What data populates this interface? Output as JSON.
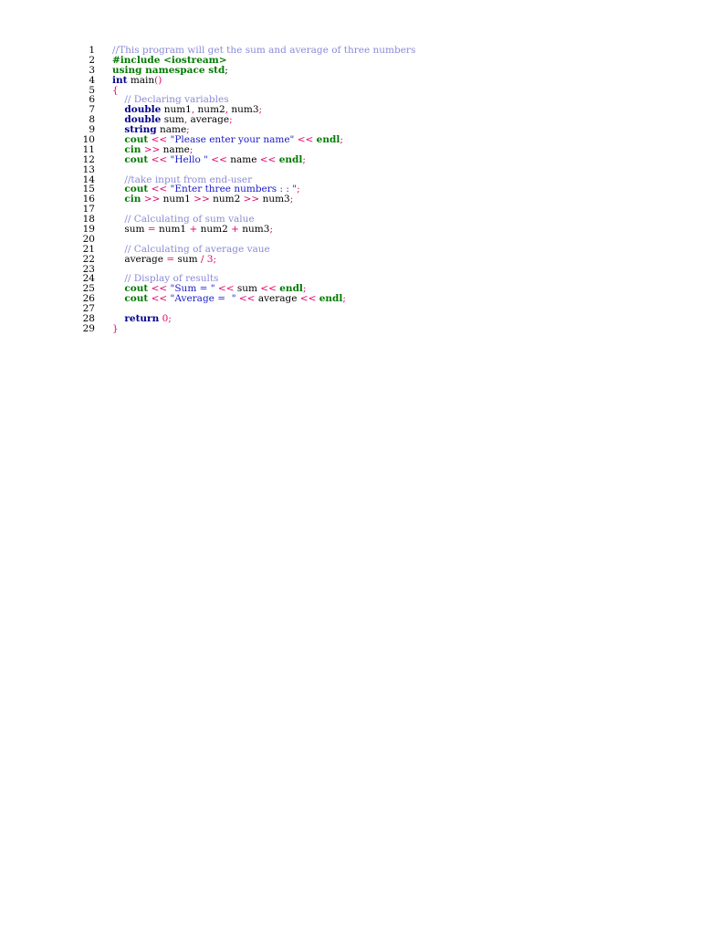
{
  "document": {
    "lines": [
      {
        "n": "1",
        "tokens": [
          {
            "t": "//This program will get the sum and average of three numbers",
            "c": "comment"
          }
        ]
      },
      {
        "n": "2",
        "tokens": [
          {
            "t": "#include <iostream>",
            "c": "pre"
          }
        ]
      },
      {
        "n": "3",
        "tokens": [
          {
            "t": "using namespace ",
            "c": "stdkw"
          },
          {
            "t": "std",
            "c": "stdkw"
          },
          {
            "t": ";",
            "c": "punct"
          }
        ]
      },
      {
        "n": "4",
        "tokens": [
          {
            "t": "int",
            "c": "kw"
          },
          {
            "t": " main",
            "c": "id"
          },
          {
            "t": "()",
            "c": "op"
          }
        ]
      },
      {
        "n": "5",
        "tokens": [
          {
            "t": "{",
            "c": "op"
          }
        ]
      },
      {
        "n": "6",
        "tokens": [
          {
            "t": "    // Declaring variables",
            "c": "comment"
          }
        ]
      },
      {
        "n": "7",
        "tokens": [
          {
            "t": "    ",
            "c": "id"
          },
          {
            "t": "double",
            "c": "kw"
          },
          {
            "t": " num1",
            "c": "id"
          },
          {
            "t": ",",
            "c": "op"
          },
          {
            "t": " num2",
            "c": "id"
          },
          {
            "t": ",",
            "c": "op"
          },
          {
            "t": " num3",
            "c": "id"
          },
          {
            "t": ";",
            "c": "op"
          }
        ]
      },
      {
        "n": "8",
        "tokens": [
          {
            "t": "    ",
            "c": "id"
          },
          {
            "t": "double",
            "c": "kw"
          },
          {
            "t": " sum",
            "c": "id"
          },
          {
            "t": ",",
            "c": "op"
          },
          {
            "t": " average",
            "c": "id"
          },
          {
            "t": ";",
            "c": "op"
          }
        ]
      },
      {
        "n": "9",
        "tokens": [
          {
            "t": "    ",
            "c": "id"
          },
          {
            "t": "string",
            "c": "kw"
          },
          {
            "t": " name",
            "c": "id"
          },
          {
            "t": ";",
            "c": "op"
          }
        ]
      },
      {
        "n": "10",
        "tokens": [
          {
            "t": "    ",
            "c": "id"
          },
          {
            "t": "cout",
            "c": "stdkw"
          },
          {
            "t": " << ",
            "c": "op"
          },
          {
            "t": "\"Please enter your name\"",
            "c": "str"
          },
          {
            "t": " << ",
            "c": "op"
          },
          {
            "t": "endl",
            "c": "stdkw"
          },
          {
            "t": ";",
            "c": "op"
          }
        ]
      },
      {
        "n": "11",
        "tokens": [
          {
            "t": "    ",
            "c": "id"
          },
          {
            "t": "cin",
            "c": "stdkw"
          },
          {
            "t": " >> ",
            "c": "op"
          },
          {
            "t": "name",
            "c": "id"
          },
          {
            "t": ";",
            "c": "op"
          }
        ]
      },
      {
        "n": "12",
        "tokens": [
          {
            "t": "    ",
            "c": "id"
          },
          {
            "t": "cout",
            "c": "stdkw"
          },
          {
            "t": " << ",
            "c": "op"
          },
          {
            "t": "\"Hello \"",
            "c": "str"
          },
          {
            "t": " << ",
            "c": "op"
          },
          {
            "t": "name",
            "c": "id"
          },
          {
            "t": " << ",
            "c": "op"
          },
          {
            "t": "endl",
            "c": "stdkw"
          },
          {
            "t": ";",
            "c": "op"
          }
        ]
      },
      {
        "n": "13",
        "tokens": []
      },
      {
        "n": "14",
        "tokens": [
          {
            "t": "    //take input from end-user",
            "c": "comment"
          }
        ]
      },
      {
        "n": "15",
        "tokens": [
          {
            "t": "    ",
            "c": "id"
          },
          {
            "t": "cout",
            "c": "stdkw"
          },
          {
            "t": " << ",
            "c": "op"
          },
          {
            "t": "\"Enter three numbers : : \"",
            "c": "str"
          },
          {
            "t": ";",
            "c": "op"
          }
        ]
      },
      {
        "n": "16",
        "tokens": [
          {
            "t": "    ",
            "c": "id"
          },
          {
            "t": "cin",
            "c": "stdkw"
          },
          {
            "t": " >> ",
            "c": "op"
          },
          {
            "t": "num1",
            "c": "id"
          },
          {
            "t": " >> ",
            "c": "op"
          },
          {
            "t": "num2",
            "c": "id"
          },
          {
            "t": " >> ",
            "c": "op"
          },
          {
            "t": "num3",
            "c": "id"
          },
          {
            "t": ";",
            "c": "op"
          }
        ]
      },
      {
        "n": "17",
        "tokens": []
      },
      {
        "n": "18",
        "tokens": [
          {
            "t": "    // Calculating of sum value",
            "c": "comment"
          }
        ]
      },
      {
        "n": "19",
        "tokens": [
          {
            "t": "    sum",
            "c": "id"
          },
          {
            "t": " = ",
            "c": "op"
          },
          {
            "t": "num1",
            "c": "id"
          },
          {
            "t": " + ",
            "c": "op"
          },
          {
            "t": "num2",
            "c": "id"
          },
          {
            "t": " + ",
            "c": "op"
          },
          {
            "t": "num3",
            "c": "id"
          },
          {
            "t": ";",
            "c": "op"
          }
        ]
      },
      {
        "n": "20",
        "tokens": []
      },
      {
        "n": "21",
        "tokens": [
          {
            "t": "    // Calculating of average vaue",
            "c": "comment"
          }
        ]
      },
      {
        "n": "22",
        "tokens": [
          {
            "t": "    average",
            "c": "id"
          },
          {
            "t": " = ",
            "c": "op"
          },
          {
            "t": "sum",
            "c": "id"
          },
          {
            "t": " / ",
            "c": "op"
          },
          {
            "t": "3",
            "c": "num"
          },
          {
            "t": ";",
            "c": "op"
          }
        ]
      },
      {
        "n": "23",
        "tokens": []
      },
      {
        "n": "24",
        "tokens": [
          {
            "t": "    // Display of results",
            "c": "comment"
          }
        ]
      },
      {
        "n": "25",
        "tokens": [
          {
            "t": "    ",
            "c": "id"
          },
          {
            "t": "cout",
            "c": "stdkw"
          },
          {
            "t": " << ",
            "c": "op"
          },
          {
            "t": "\"Sum = \"",
            "c": "str"
          },
          {
            "t": " << ",
            "c": "op"
          },
          {
            "t": "sum",
            "c": "id"
          },
          {
            "t": " << ",
            "c": "op"
          },
          {
            "t": "endl",
            "c": "stdkw"
          },
          {
            "t": ";",
            "c": "op"
          }
        ]
      },
      {
        "n": "26",
        "tokens": [
          {
            "t": "    ",
            "c": "id"
          },
          {
            "t": "cout",
            "c": "stdkw"
          },
          {
            "t": " << ",
            "c": "op"
          },
          {
            "t": "\"Average =  \"",
            "c": "str"
          },
          {
            "t": " << ",
            "c": "op"
          },
          {
            "t": "average",
            "c": "id"
          },
          {
            "t": " << ",
            "c": "op"
          },
          {
            "t": "endl",
            "c": "stdkw"
          },
          {
            "t": ";",
            "c": "op"
          }
        ]
      },
      {
        "n": "27",
        "tokens": []
      },
      {
        "n": "28",
        "tokens": [
          {
            "t": "    ",
            "c": "id"
          },
          {
            "t": "return",
            "c": "kw"
          },
          {
            "t": " ",
            "c": "id"
          },
          {
            "t": "0",
            "c": "num"
          },
          {
            "t": ";",
            "c": "op"
          }
        ]
      },
      {
        "n": "29",
        "tokens": [
          {
            "t": "}",
            "c": "op"
          }
        ]
      }
    ]
  }
}
